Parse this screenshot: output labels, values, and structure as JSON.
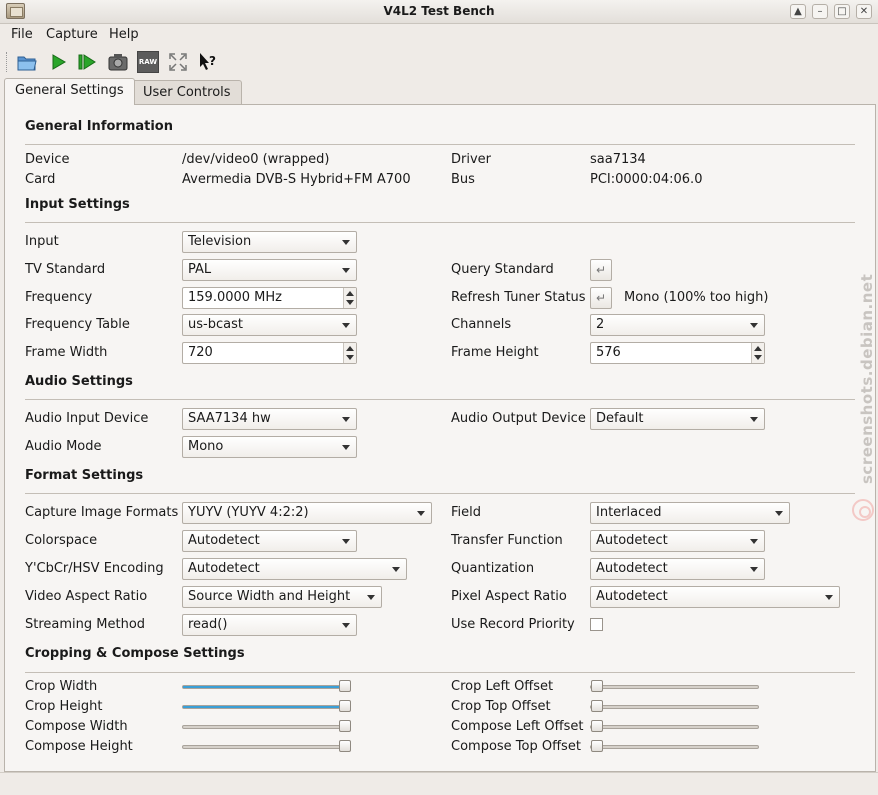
{
  "window": {
    "title": "V4L2 Test Bench"
  },
  "menu": {
    "file": "File",
    "capture": "Capture",
    "help": "Help"
  },
  "toolbar": {
    "raw_label": "RAW"
  },
  "tabs": {
    "general": "General Settings",
    "user": "User Controls"
  },
  "sections": {
    "general_info": "General Information",
    "input": "Input Settings",
    "audio": "Audio Settings",
    "format": "Format Settings",
    "crop": "Cropping & Compose Settings"
  },
  "general_info": {
    "device_label": "Device",
    "device_value": "/dev/video0 (wrapped)",
    "card_label": "Card",
    "card_value": "Avermedia DVB-S Hybrid+FM A700",
    "driver_label": "Driver",
    "driver_value": "saa7134",
    "bus_label": "Bus",
    "bus_value": "PCI:0000:04:06.0"
  },
  "input": {
    "input_label": "Input",
    "input_value": "Television",
    "tv_standard_label": "TV Standard",
    "tv_standard_value": "PAL",
    "query_standard_label": "Query Standard",
    "frequency_label": "Frequency",
    "frequency_value": "159.0000 MHz",
    "refresh_tuner_label": "Refresh Tuner Status",
    "tuner_status": "Mono (100% too high)",
    "freq_table_label": "Frequency Table",
    "freq_table_value": "us-bcast",
    "channels_label": "Channels",
    "channels_value": "2",
    "frame_width_label": "Frame Width",
    "frame_width_value": "720",
    "frame_height_label": "Frame Height",
    "frame_height_value": "576"
  },
  "audio": {
    "input_device_label": "Audio Input Device",
    "input_device_value": "SAA7134 hw",
    "output_device_label": "Audio Output Device",
    "output_device_value": "Default",
    "mode_label": "Audio Mode",
    "mode_value": "Mono"
  },
  "format": {
    "capture_formats_label": "Capture Image Formats",
    "capture_formats_value": "YUYV (YUYV 4:2:2)",
    "field_label": "Field",
    "field_value": "Interlaced",
    "colorspace_label": "Colorspace",
    "colorspace_value": "Autodetect",
    "transfer_label": "Transfer Function",
    "transfer_value": "Autodetect",
    "encoding_label": "Y'CbCr/HSV Encoding",
    "encoding_value": "Autodetect",
    "quantization_label": "Quantization",
    "quantization_value": "Autodetect",
    "video_aspect_label": "Video Aspect Ratio",
    "video_aspect_value": "Source Width and Height",
    "pixel_aspect_label": "Pixel Aspect Ratio",
    "pixel_aspect_value": "Autodetect",
    "streaming_label": "Streaming Method",
    "streaming_value": "read()",
    "record_priority_label": "Use Record Priority"
  },
  "crop": {
    "crop_width_label": "Crop Width",
    "crop_width_level": 1.0,
    "crop_height_label": "Crop Height",
    "crop_height_level": 1.0,
    "compose_width_label": "Compose Width",
    "compose_width_level": 1.0,
    "compose_height_label": "Compose Height",
    "compose_height_level": 1.0,
    "crop_left_label": "Crop Left Offset",
    "crop_left_level": 0.0,
    "crop_top_label": "Crop Top Offset",
    "crop_top_level": 0.0,
    "compose_left_label": "Compose Left Offset",
    "compose_left_level": 0.0,
    "compose_top_label": "Compose Top Offset",
    "compose_top_level": 0.0
  },
  "watermark": {
    "text": "screenshots.debian.net"
  },
  "colors": {
    "slider_fill": "#3b9fd6",
    "panel": "#f7f5f3",
    "window": "#efebe7"
  }
}
